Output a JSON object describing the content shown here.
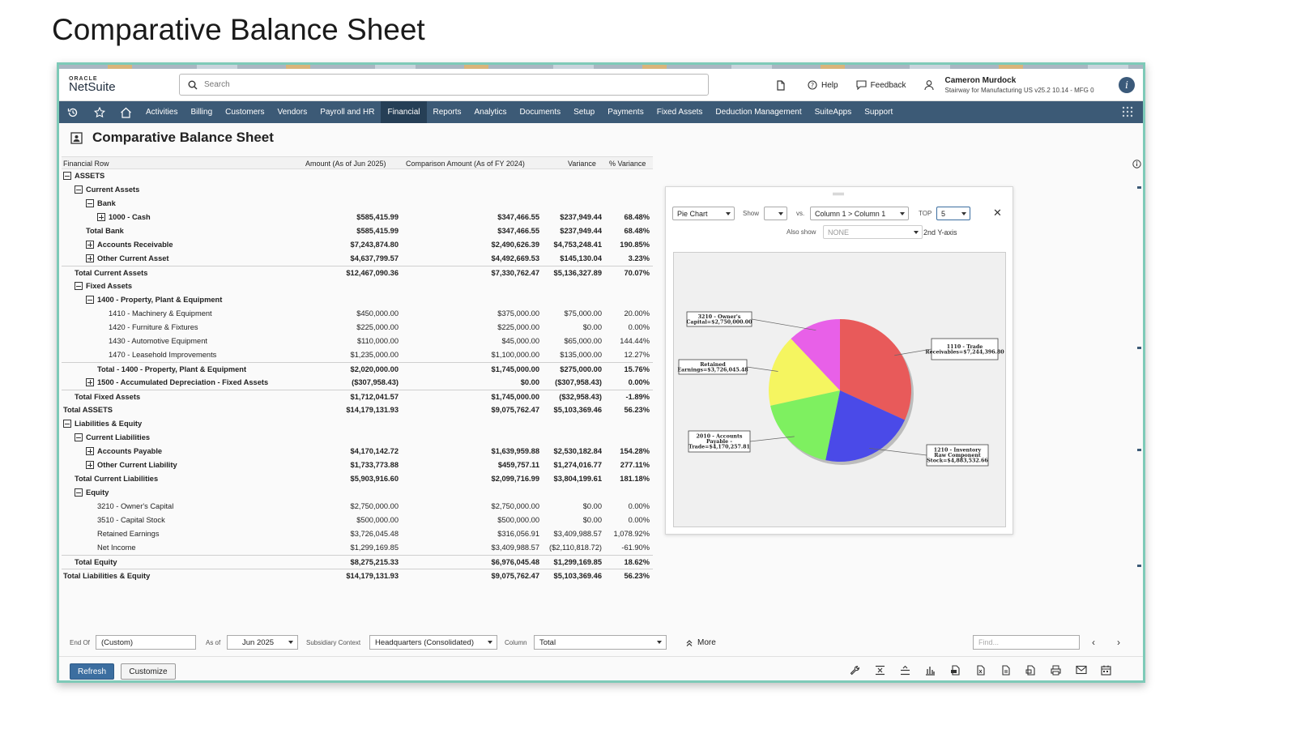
{
  "slide_title": "Comparative Balance Sheet",
  "header": {
    "logo_top": "ORACLE",
    "logo_name": "NetSuite",
    "search_placeholder": "Search",
    "help": "Help",
    "feedback": "Feedback",
    "user_name": "Cameron Murdock",
    "user_role": "Stairway for Manufacturing US v25.2 10.14 - MFG 0"
  },
  "nav": {
    "items": [
      "Activities",
      "Billing",
      "Customers",
      "Vendors",
      "Payroll and HR",
      "Financial",
      "Reports",
      "Analytics",
      "Documents",
      "Setup",
      "Payments",
      "Fixed Assets",
      "Deduction Management",
      "SuiteApps",
      "Support"
    ],
    "active": "Financial"
  },
  "page_title": "Comparative Balance Sheet",
  "table": {
    "headers": [
      "Financial Row",
      "Amount (As of Jun 2025)",
      "Comparison Amount (As of FY 2024)",
      "Variance",
      "% Variance"
    ],
    "rows": [
      {
        "label": "ASSETS",
        "indent": 0,
        "toggle": "minus",
        "bold": true,
        "v": [
          "",
          "",
          "",
          ""
        ]
      },
      {
        "label": "Current Assets",
        "indent": 1,
        "toggle": "minus",
        "bold": true,
        "v": [
          "",
          "",
          "",
          ""
        ]
      },
      {
        "label": "Bank",
        "indent": 2,
        "toggle": "minus",
        "bold": true,
        "v": [
          "",
          "",
          "",
          ""
        ]
      },
      {
        "label": "1000 - Cash",
        "indent": 3,
        "toggle": "plus",
        "bold": true,
        "v": [
          "$585,415.99",
          "$347,466.55",
          "$237,949.44",
          "68.48%"
        ]
      },
      {
        "label": "Total Bank",
        "indent": 2,
        "toggle": "",
        "bold": true,
        "v": [
          "$585,415.99",
          "$347,466.55",
          "$237,949.44",
          "68.48%"
        ]
      },
      {
        "label": "Accounts Receivable",
        "indent": 2,
        "toggle": "plus",
        "bold": true,
        "v": [
          "$7,243,874.80",
          "$2,490,626.39",
          "$4,753,248.41",
          "190.85%"
        ]
      },
      {
        "label": "Other Current Asset",
        "indent": 2,
        "toggle": "plus",
        "bold": true,
        "v": [
          "$4,637,799.57",
          "$4,492,669.53",
          "$145,130.04",
          "3.23%"
        ]
      },
      {
        "label": "Total Current Assets",
        "indent": 1,
        "toggle": "",
        "bold": true,
        "line": true,
        "v": [
          "$12,467,090.36",
          "$7,330,762.47",
          "$5,136,327.89",
          "70.07%"
        ]
      },
      {
        "label": "Fixed Assets",
        "indent": 1,
        "toggle": "minus",
        "bold": true,
        "v": [
          "",
          "",
          "",
          ""
        ]
      },
      {
        "label": "1400 - Property, Plant & Equipment",
        "indent": 2,
        "toggle": "minus",
        "bold": true,
        "v": [
          "",
          "",
          "",
          ""
        ]
      },
      {
        "label": "1410 - Machinery & Equipment",
        "indent": 4,
        "toggle": "",
        "bold": false,
        "v": [
          "$450,000.00",
          "$375,000.00",
          "$75,000.00",
          "20.00%"
        ]
      },
      {
        "label": "1420 - Furniture & Fixtures",
        "indent": 4,
        "toggle": "",
        "bold": false,
        "v": [
          "$225,000.00",
          "$225,000.00",
          "$0.00",
          "0.00%"
        ]
      },
      {
        "label": "1430 - Automotive Equipment",
        "indent": 4,
        "toggle": "",
        "bold": false,
        "v": [
          "$110,000.00",
          "$45,000.00",
          "$65,000.00",
          "144.44%"
        ]
      },
      {
        "label": "1470 - Leasehold Improvements",
        "indent": 4,
        "toggle": "",
        "bold": false,
        "v": [
          "$1,235,000.00",
          "$1,100,000.00",
          "$135,000.00",
          "12.27%"
        ]
      },
      {
        "label": "Total - 1400 - Property, Plant & Equipment",
        "indent": 3,
        "toggle": "",
        "bold": true,
        "line": true,
        "v": [
          "$2,020,000.00",
          "$1,745,000.00",
          "$275,000.00",
          "15.76%"
        ]
      },
      {
        "label": "1500 - Accumulated Depreciation - Fixed Assets",
        "indent": 2,
        "toggle": "plus",
        "bold": true,
        "v": [
          "($307,958.43)",
          "$0.00",
          "($307,958.43)",
          "0.00%"
        ]
      },
      {
        "label": "Total Fixed Assets",
        "indent": 1,
        "toggle": "",
        "bold": true,
        "line": true,
        "v": [
          "$1,712,041.57",
          "$1,745,000.00",
          "($32,958.43)",
          "-1.89%"
        ]
      },
      {
        "label": "Total ASSETS",
        "indent": 0,
        "toggle": "",
        "bold": true,
        "v": [
          "$14,179,131.93",
          "$9,075,762.47",
          "$5,103,369.46",
          "56.23%"
        ]
      },
      {
        "label": "Liabilities & Equity",
        "indent": 0,
        "toggle": "minus",
        "bold": true,
        "v": [
          "",
          "",
          "",
          ""
        ]
      },
      {
        "label": "Current Liabilities",
        "indent": 1,
        "toggle": "minus",
        "bold": true,
        "v": [
          "",
          "",
          "",
          ""
        ]
      },
      {
        "label": "Accounts Payable",
        "indent": 2,
        "toggle": "plus",
        "bold": true,
        "v": [
          "$4,170,142.72",
          "$1,639,959.88",
          "$2,530,182.84",
          "154.28%"
        ]
      },
      {
        "label": "Other Current Liability",
        "indent": 2,
        "toggle": "plus",
        "bold": true,
        "v": [
          "$1,733,773.88",
          "$459,757.11",
          "$1,274,016.77",
          "277.11%"
        ]
      },
      {
        "label": "Total Current Liabilities",
        "indent": 1,
        "toggle": "",
        "bold": true,
        "v": [
          "$5,903,916.60",
          "$2,099,716.99",
          "$3,804,199.61",
          "181.18%"
        ]
      },
      {
        "label": "Equity",
        "indent": 1,
        "toggle": "minus",
        "bold": true,
        "v": [
          "",
          "",
          "",
          ""
        ]
      },
      {
        "label": "3210 - Owner's Capital",
        "indent": 3,
        "toggle": "",
        "bold": false,
        "v": [
          "$2,750,000.00",
          "$2,750,000.00",
          "$0.00",
          "0.00%"
        ]
      },
      {
        "label": "3510 - Capital Stock",
        "indent": 3,
        "toggle": "",
        "bold": false,
        "v": [
          "$500,000.00",
          "$500,000.00",
          "$0.00",
          "0.00%"
        ]
      },
      {
        "label": "Retained Earnings",
        "indent": 3,
        "toggle": "",
        "bold": false,
        "v": [
          "$3,726,045.48",
          "$316,056.91",
          "$3,409,988.57",
          "1,078.92%"
        ]
      },
      {
        "label": "Net Income",
        "indent": 3,
        "toggle": "",
        "bold": false,
        "v": [
          "$1,299,169.85",
          "$3,409,988.57",
          "($2,110,818.72)",
          "-61.90%"
        ]
      },
      {
        "label": "Total Equity",
        "indent": 1,
        "toggle": "",
        "bold": true,
        "line": true,
        "v": [
          "$8,275,215.33",
          "$6,976,045.48",
          "$1,299,169.85",
          "18.62%"
        ]
      },
      {
        "label": "Total Liabilities & Equity",
        "indent": 0,
        "toggle": "",
        "bold": true,
        "line": true,
        "v": [
          "$14,179,131.93",
          "$9,075,762.47",
          "$5,103,369.46",
          "56.23%"
        ]
      }
    ]
  },
  "chart_panel": {
    "chart_type": "Pie Chart",
    "show_label": "Show",
    "show_value": "",
    "vs_label": "vs.",
    "column_value": "Column 1 > Column 1",
    "top_label": "TOP",
    "top_value": "5",
    "also_show_label": "Also show",
    "also_show_value": "NONE",
    "second_axis": "2nd Y-axis"
  },
  "chart_data": {
    "type": "pie",
    "slices": [
      {
        "label": "1110 - Trade Receivables=$7,244,396.80",
        "value": 7244396.8,
        "color": "#e85a5a"
      },
      {
        "label": "1210 - Inventory Raw Component Stock=$4,883,532.66",
        "value": 4883532.66,
        "color": "#4a4ae8"
      },
      {
        "label": "2010 - Accounts Payable - Trade=$4,170,257.81",
        "value": 4170257.81,
        "color": "#7ef060"
      },
      {
        "label": "Retained Earnings=$3,726,045.48",
        "value": 3726045.48,
        "color": "#f5f560"
      },
      {
        "label": "3210 - Owner's Capital=$2,750,000.00",
        "value": 2750000.0,
        "color": "#e860e8"
      }
    ]
  },
  "filters": {
    "end_of_label": "End Of",
    "end_of_value": "(Custom)",
    "as_of_label": "As of",
    "as_of_value": "Jun 2025",
    "subsidiary_label": "Subsidiary Context",
    "subsidiary_value": "Headquarters (Consolidated)",
    "column_label": "Column",
    "column_value": "Total",
    "more": "More",
    "find_placeholder": "Find..."
  },
  "buttons": {
    "refresh": "Refresh",
    "customize": "Customize"
  }
}
